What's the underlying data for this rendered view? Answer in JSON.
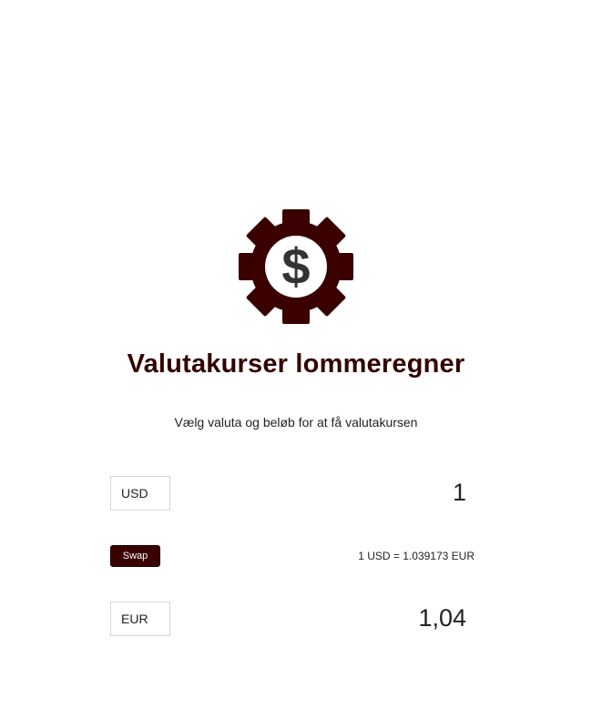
{
  "header": {
    "title": "Valutakurser lommeregner",
    "subtitle": "Vælg valuta og beløb for at få valutakursen",
    "logo_icon": "gear-dollar-icon"
  },
  "converter": {
    "from_currency": "USD",
    "from_amount": "1",
    "to_currency": "EUR",
    "to_amount": "1,04",
    "swap_label": "Swap",
    "rate_text": "1 USD = 1.039173 EUR"
  },
  "colors": {
    "brand": "#3a0000",
    "title": "#330000",
    "dollar": "#333333"
  }
}
